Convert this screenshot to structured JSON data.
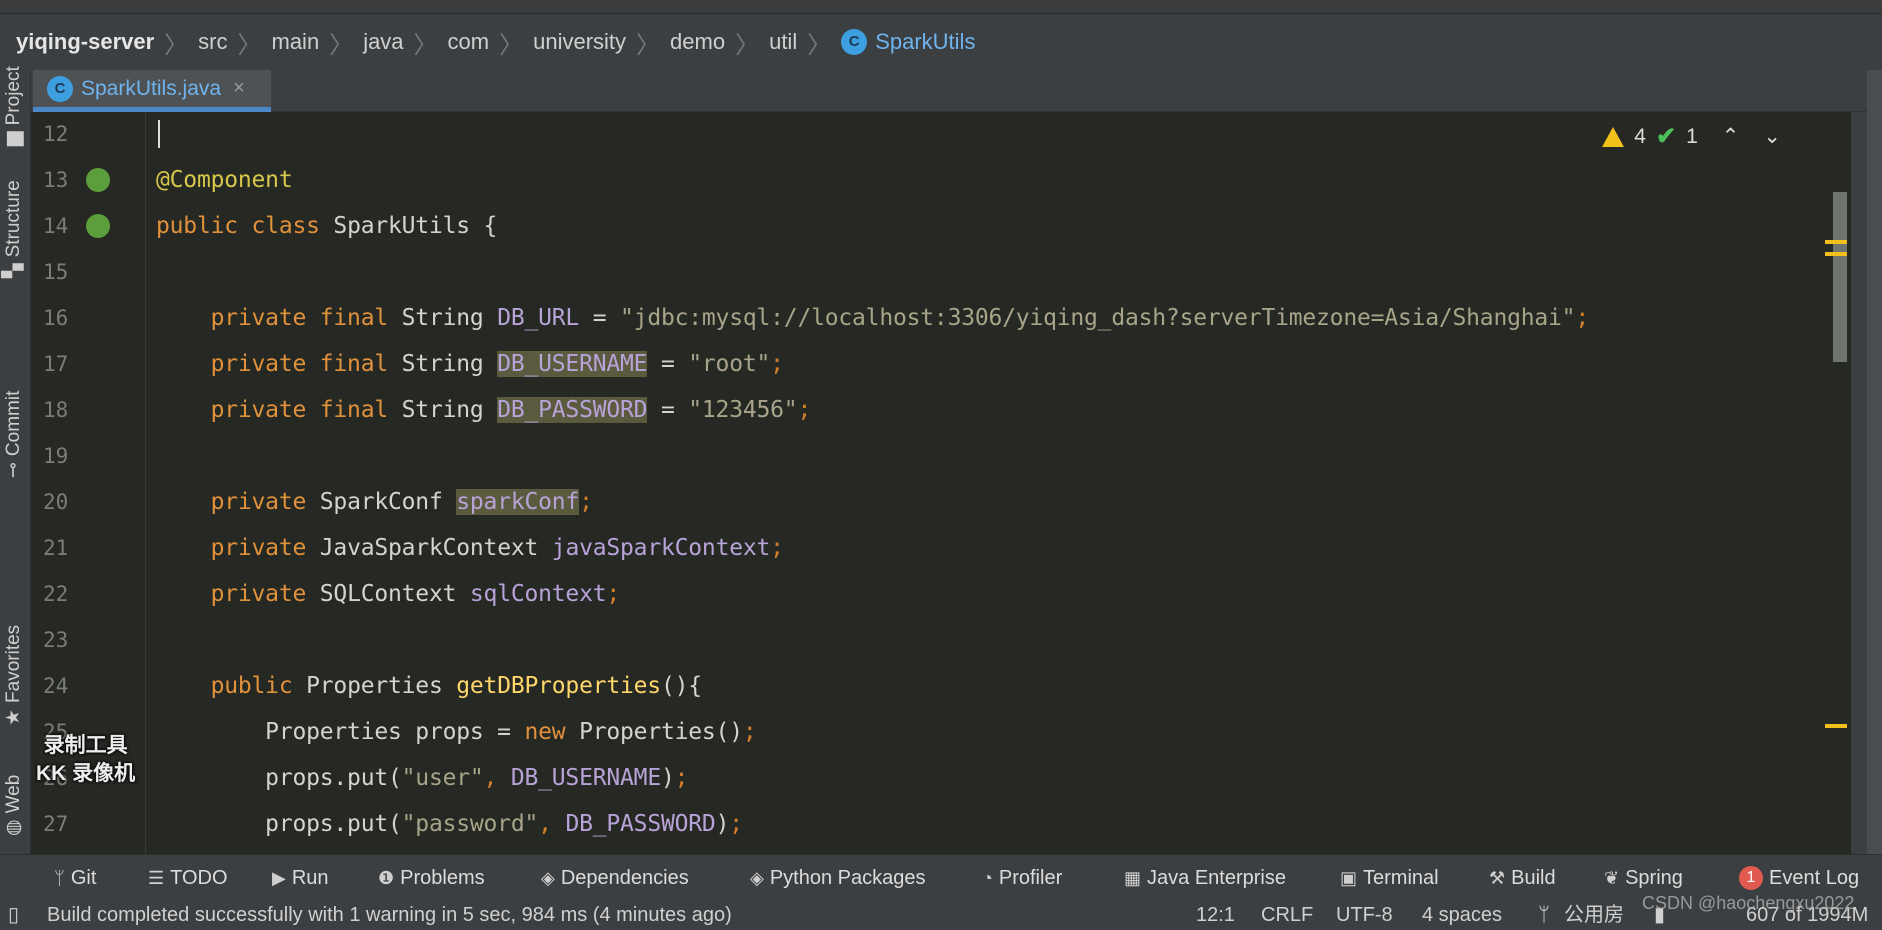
{
  "breadcrumb": {
    "items": [
      "yiqing-server",
      "src",
      "main",
      "java",
      "com",
      "university",
      "demo",
      "util"
    ],
    "current": "SparkUtils",
    "class_icon": "C"
  },
  "tabs": [
    {
      "label": "SparkUtils.java",
      "icon": "C",
      "close": "×"
    }
  ],
  "left_stripe": [
    "Project",
    "Structure",
    "Commit",
    "Favorites",
    "Web"
  ],
  "inspections": {
    "warnings": "4",
    "weak_warnings": "1"
  },
  "editor": {
    "lines": [
      {
        "n": "12",
        "tokens": []
      },
      {
        "n": "13",
        "icon": "bean-icon",
        "tokens": [
          {
            "t": "@Component",
            "c": "an"
          }
        ]
      },
      {
        "n": "14",
        "icon": "bean-class-icon",
        "tokens": [
          {
            "t": "public class ",
            "c": "kw"
          },
          {
            "t": "SparkUtils {",
            "c": ""
          }
        ]
      },
      {
        "n": "15",
        "tokens": []
      },
      {
        "n": "16",
        "tokens": [
          {
            "t": "    private final ",
            "c": "kw"
          },
          {
            "t": "String ",
            "c": ""
          },
          {
            "t": "DB_URL",
            "c": "fd"
          },
          {
            "t": " = ",
            "c": ""
          },
          {
            "t": "\"jdbc:mysql://localhost:3306/yiqing_dash?serverTimezone=Asia/Shanghai\"",
            "c": "st"
          },
          {
            "t": ";",
            "c": "pn"
          }
        ]
      },
      {
        "n": "17",
        "tokens": [
          {
            "t": "    private final ",
            "c": "kw"
          },
          {
            "t": "String ",
            "c": ""
          },
          {
            "t": "DB_USERNAME",
            "c": "fd hl"
          },
          {
            "t": " = ",
            "c": ""
          },
          {
            "t": "\"root\"",
            "c": "st"
          },
          {
            "t": ";",
            "c": "pn"
          }
        ]
      },
      {
        "n": "18",
        "tokens": [
          {
            "t": "    private final ",
            "c": "kw"
          },
          {
            "t": "String ",
            "c": ""
          },
          {
            "t": "DB_PASSWORD",
            "c": "fd hl"
          },
          {
            "t": " = ",
            "c": ""
          },
          {
            "t": "\"123456\"",
            "c": "st"
          },
          {
            "t": ";",
            "c": "pn"
          }
        ]
      },
      {
        "n": "19",
        "tokens": []
      },
      {
        "n": "20",
        "tokens": [
          {
            "t": "    private ",
            "c": "kw"
          },
          {
            "t": "SparkConf ",
            "c": ""
          },
          {
            "t": "sparkConf",
            "c": "fd hl"
          },
          {
            "t": ";",
            "c": "pn"
          }
        ]
      },
      {
        "n": "21",
        "tokens": [
          {
            "t": "    private ",
            "c": "kw"
          },
          {
            "t": "JavaSparkContext ",
            "c": ""
          },
          {
            "t": "javaSparkContext",
            "c": "fd"
          },
          {
            "t": ";",
            "c": "pn"
          }
        ]
      },
      {
        "n": "22",
        "tokens": [
          {
            "t": "    private ",
            "c": "kw"
          },
          {
            "t": "SQLContext ",
            "c": ""
          },
          {
            "t": "sqlContext",
            "c": "fd"
          },
          {
            "t": ";",
            "c": "pn"
          }
        ]
      },
      {
        "n": "23",
        "tokens": []
      },
      {
        "n": "24",
        "tokens": [
          {
            "t": "    public ",
            "c": "kw"
          },
          {
            "t": "Properties ",
            "c": ""
          },
          {
            "t": "getDBProperties",
            "c": "fn"
          },
          {
            "t": "(){",
            "c": ""
          }
        ]
      },
      {
        "n": "25",
        "tokens": [
          {
            "t": "        Properties props = ",
            "c": ""
          },
          {
            "t": "new ",
            "c": "kw"
          },
          {
            "t": "Properties()",
            "c": ""
          },
          {
            "t": ";",
            "c": "pn"
          }
        ]
      },
      {
        "n": "26",
        "tokens": [
          {
            "t": "        props.put(",
            "c": ""
          },
          {
            "t": "\"user\"",
            "c": "st"
          },
          {
            "t": ", ",
            "c": "pn"
          },
          {
            "t": "DB_USERNAME",
            "c": "fd"
          },
          {
            "t": ")",
            "c": ""
          },
          {
            "t": ";",
            "c": "pn"
          }
        ]
      },
      {
        "n": "27",
        "tokens": [
          {
            "t": "        props.put(",
            "c": ""
          },
          {
            "t": "\"password\"",
            "c": "st"
          },
          {
            "t": ", ",
            "c": "pn"
          },
          {
            "t": "DB_PASSWORD",
            "c": "fd"
          },
          {
            "t": ")",
            "c": ""
          },
          {
            "t": ";",
            "c": "pn"
          }
        ]
      }
    ]
  },
  "recorder_watermark": [
    "录制工具",
    "KK 录像机"
  ],
  "tool_windows": [
    {
      "label": "Git",
      "icon": "git-icon",
      "glyph": "ᛘ"
    },
    {
      "label": "TODO",
      "icon": "list-icon",
      "glyph": "☰"
    },
    {
      "label": "Run",
      "icon": "run-icon",
      "glyph": "▶"
    },
    {
      "label": "Problems",
      "icon": "problems-icon",
      "glyph": "❶"
    },
    {
      "label": "Dependencies",
      "icon": "dependencies-icon",
      "glyph": "◈"
    },
    {
      "label": "Python Packages",
      "icon": "packages-icon",
      "glyph": "◈"
    },
    {
      "label": "Profiler",
      "icon": "profiler-icon",
      "glyph": "◔"
    },
    {
      "label": "Java Enterprise",
      "icon": "java-enterprise-icon",
      "glyph": "▦"
    },
    {
      "label": "Terminal",
      "icon": "terminal-icon",
      "glyph": "▣"
    },
    {
      "label": "Build",
      "icon": "hammer-icon",
      "glyph": "⚒"
    },
    {
      "label": "Spring",
      "icon": "spring-icon",
      "glyph": "❦"
    },
    {
      "label": "Event Log",
      "icon": "event-log-icon",
      "badge": "1"
    }
  ],
  "status": {
    "message": "Build completed successfully with 1 warning in 5 sec, 984 ms (4 minutes ago)",
    "position": "12:1",
    "line_separator": "CRLF",
    "encoding": "UTF-8",
    "indent": "4 spaces",
    "branch": "公用房",
    "memory": "607 of 1994M"
  },
  "watermark": "CSDN @haochengxu2022"
}
